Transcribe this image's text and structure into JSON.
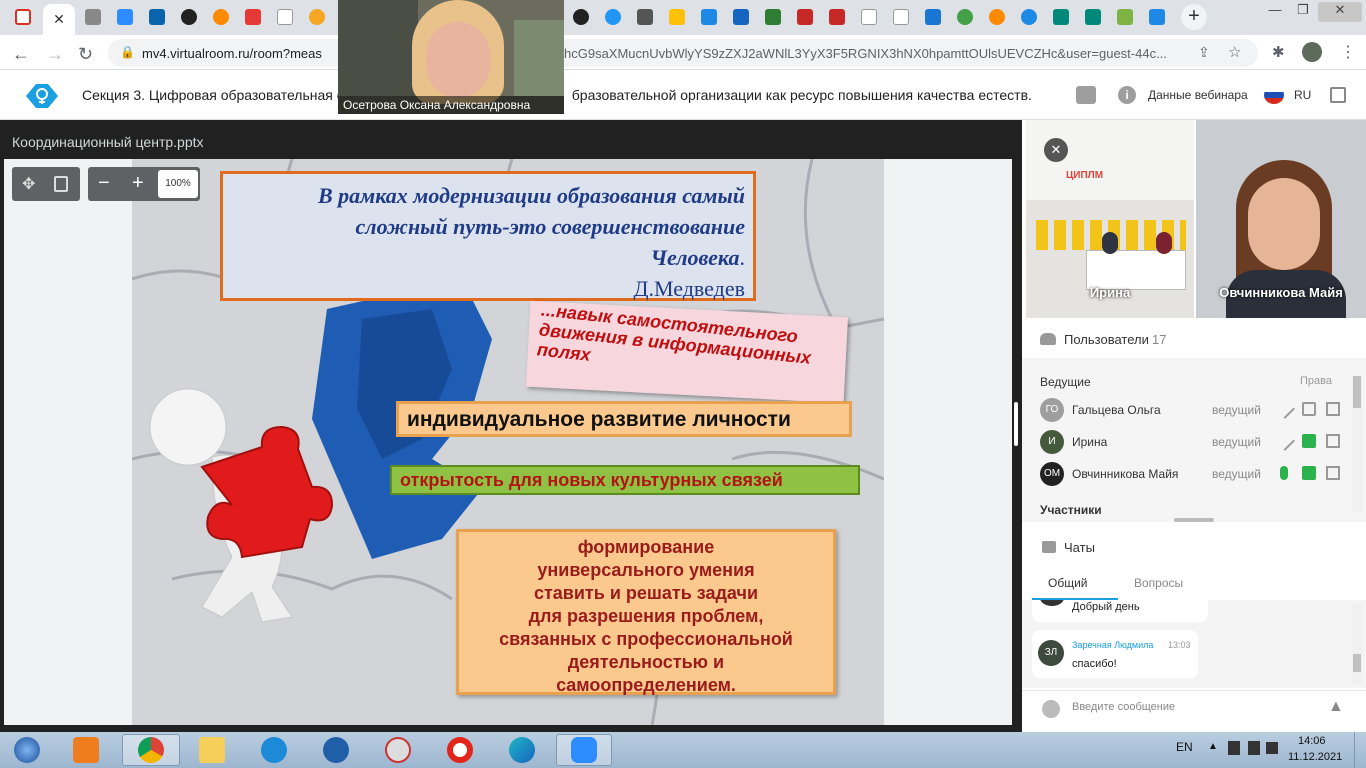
{
  "browser": {
    "url_host": "mv4.virtualroom.ru/room?meas",
    "url_rest": "hcG9saXMucnUvbWlyYS9zZXJ2aWNlL3YyX3F5RGNIX3hNX0hpamttOUlsUEVCZHc&user=guest-44c..."
  },
  "app": {
    "title": "Секция 3. Цифровая образовательная с",
    "title_tail": "бразовательной организации как ресурс повышения качества естеств...",
    "webinar_data": "Данные вебинара",
    "lang": "RU"
  },
  "presenter": {
    "name": "Осетрова Оксана Александровна"
  },
  "slide": {
    "filename": "Координационный центр.pptx",
    "zoom": "100%",
    "quote_l1": "В рамках модернизации образования самый",
    "quote_l2": "сложный путь-это совершенствование",
    "quote_l3": "Человека",
    "quote_dot": ".",
    "author": "Д.Медведев",
    "pink_text": "...навык самостоятельного движения в информационных полях",
    "orange_bar": "индивидуальное развитие личности",
    "green_bar": "открытость для новых культурных связей",
    "box_lines": [
      "формирование",
      "универсального умения",
      "ставить и решать задачи",
      "для разрешения проблем,",
      "связанных с профессиональной",
      "деятельностью и",
      "самоопределением."
    ]
  },
  "videos": [
    {
      "name": "Ирина",
      "brand": "ЦИПЛМ"
    },
    {
      "name": "Овчинникова Майя"
    }
  ],
  "users": {
    "header": "Пользователи",
    "count": "17",
    "hosts_label": "Ведущие",
    "rights_label": "Права",
    "participants_label": "Участники",
    "list": [
      {
        "initials": "ГО",
        "name": "Гальцева Ольга",
        "role": "ведущий",
        "color": "#9e9e9e"
      },
      {
        "initials": "И",
        "name": "Ирина",
        "role": "ведущий",
        "color": "#455a3c"
      },
      {
        "initials": "ОМ",
        "name": "Овчинникова Майя",
        "role": "ведущий",
        "color": "#222222"
      }
    ]
  },
  "chat": {
    "header": "Чаты",
    "tab_general": "Общий",
    "tab_questions": "Вопросы",
    "msg1_text": "Добрый день",
    "msg2_initials": "ЗЛ",
    "msg2_author": "Заречная Людмила",
    "msg2_time": "13:03",
    "msg2_text": "спасибо!",
    "input_placeholder": "Введите сообщение"
  },
  "taskbar": {
    "lang": "EN",
    "time": "14:06",
    "date": "11.12.2021"
  },
  "colors": {
    "accent": "#1a9fe0",
    "slide_title_blue": "#1f3b86",
    "dark_red": "#9a1b1b"
  }
}
